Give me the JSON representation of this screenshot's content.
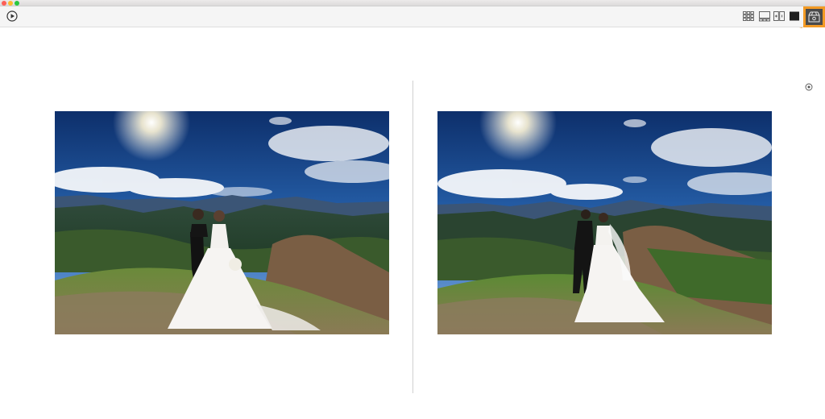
{
  "window": {
    "controls": [
      "close",
      "minimize",
      "maximize"
    ]
  },
  "toolbar": {
    "left_icon": "play-icon",
    "right_icons": [
      "grid-view-icon",
      "filmstrip-view-icon",
      "compare-view-icon",
      "single-view-icon",
      "slideshow-icon"
    ],
    "highlight_color": "#f39a24"
  },
  "viewer": {
    "photos": [
      {
        "subject": "wedding-couple-facing-camera"
      },
      {
        "subject": "wedding-couple-facing-away"
      }
    ],
    "zoom_icon": "zoom-icon"
  }
}
